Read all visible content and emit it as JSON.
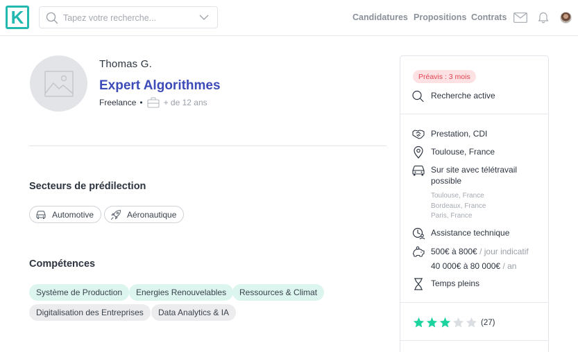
{
  "header": {
    "logo_letter": "K",
    "search": {
      "placeholder": "Tapez votre recherche..."
    },
    "nav": [
      "Candidatures",
      "Propositions",
      "Contrats"
    ],
    "icons": [
      "mail-icon",
      "bell-icon",
      "user-avatar"
    ]
  },
  "profile": {
    "name": "Thomas G.",
    "title": "Expert Algorithmes",
    "status": "Freelance",
    "separator": "•",
    "experience": "+ de 12 ans"
  },
  "sectors": {
    "title": "Secteurs de prédilection",
    "items": [
      {
        "label": "Automotive",
        "icon": "car-icon"
      },
      {
        "label": "Aéronautique",
        "icon": "rocket-icon"
      }
    ]
  },
  "skills": {
    "title": "Compétences",
    "items": [
      {
        "label": "Système de Production",
        "style": "green"
      },
      {
        "label": "Energies Renouvelables",
        "style": "green"
      },
      {
        "label": "Ressources & Climat",
        "style": "green"
      },
      {
        "label": "Digitalisation des Entreprises",
        "style": "grey"
      },
      {
        "label": "Data Analytics & IA",
        "style": "grey"
      }
    ]
  },
  "sidebar": {
    "notice": "Préavis : 3 mois",
    "search_status": "Recherche active",
    "contract": "Prestation, CDI",
    "location": "Toulouse, France",
    "remote": "Sur site avec télétravail possible",
    "cities": [
      "Toulouse, France",
      "Bordeaux, France",
      "Paris, France"
    ],
    "mission_type": "Assistance technique",
    "daily_rate": "500€ à 800€",
    "daily_rate_suffix": " / jour indicatif",
    "annual_salary": "40 000€ à 80 000€",
    "annual_salary_suffix": " / an",
    "time": "Temps pleins",
    "rating": {
      "value": 3,
      "max": 5,
      "count_label": "(27)"
    }
  },
  "colors": {
    "brand": "#23b8b0",
    "title": "#3d4bb8",
    "star_on": "#1dd3a0",
    "star_off": "#dadde1",
    "badge_text": "#e04350",
    "badge_bg": "#fde1e3"
  }
}
